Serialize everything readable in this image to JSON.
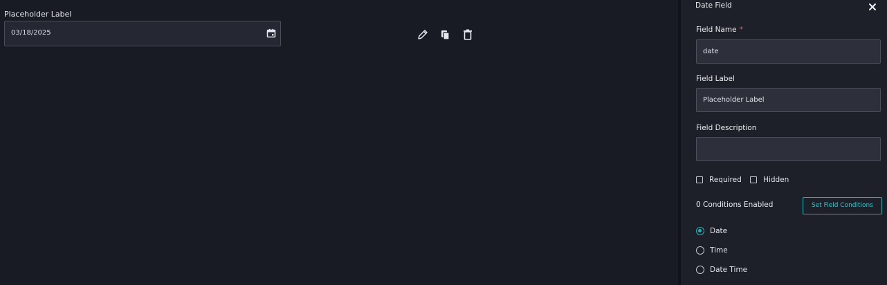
{
  "canvas": {
    "field_label": "Placeholder Label",
    "date_value": "03/18/2025",
    "toolbar": {
      "edit_icon": "pencil-icon",
      "copy_icon": "copy-icon",
      "delete_icon": "trash-icon"
    }
  },
  "panel": {
    "title": "Date Field",
    "close_icon": "close-icon",
    "field_name_label": "Field Name",
    "field_name_required_mark": "*",
    "field_name_value": "date",
    "field_label_label": "Field Label",
    "field_label_value": "Placeholder Label",
    "field_description_label": "Field Description",
    "field_description_value": "",
    "required_label": "Required",
    "hidden_label": "Hidden",
    "conditions_text": "0 Conditions Enabled",
    "set_conditions_button": "Set Field Conditions",
    "radio_options": [
      {
        "label": "Date",
        "selected": true
      },
      {
        "label": "Time",
        "selected": false
      },
      {
        "label": "Date Time",
        "selected": false
      }
    ],
    "accent_color": "#1db5bd"
  }
}
